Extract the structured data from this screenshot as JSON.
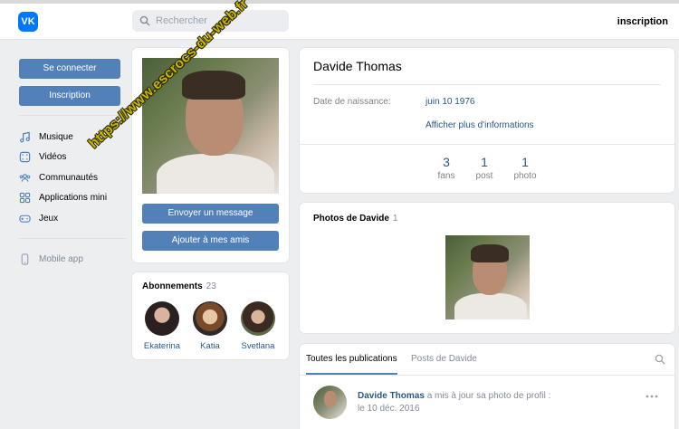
{
  "header": {
    "logo_text": "VK",
    "search_placeholder": "Rechercher",
    "signup_link": "inscription"
  },
  "left_nav": {
    "login_button": "Se connecter",
    "signup_button": "Inscription",
    "items": [
      {
        "label": "Musique",
        "icon": "music-icon"
      },
      {
        "label": "Vidéos",
        "icon": "video-icon"
      },
      {
        "label": "Communautés",
        "icon": "groups-icon"
      },
      {
        "label": "Applications mini",
        "icon": "apps-icon"
      },
      {
        "label": "Jeux",
        "icon": "gamepad-icon"
      }
    ],
    "mobile_app": "Mobile app"
  },
  "photo_card": {
    "send_message": "Envoyer un message",
    "add_friend": "Ajouter à mes amis"
  },
  "subscriptions": {
    "title": "Abonnements",
    "count": "23",
    "people": [
      {
        "name": "Ekaterina"
      },
      {
        "name": "Katia"
      },
      {
        "name": "Svetlana"
      }
    ]
  },
  "profile": {
    "name": "Davide Thomas",
    "birth_label": "Date de naissance:",
    "birth_value": "juin 10 1976",
    "more_info": "Afficher plus d'informations",
    "stats": [
      {
        "num": "3",
        "label": "fans"
      },
      {
        "num": "1",
        "label": "post"
      },
      {
        "num": "1",
        "label": "photo"
      }
    ]
  },
  "photos": {
    "title": "Photos de Davide",
    "count": "1"
  },
  "feed": {
    "tab_all": "Toutes les publications",
    "tab_own": "Posts de Davide",
    "post_author": "Davide Thomas",
    "post_action": "a mis à jour sa photo de profil :",
    "post_date": "le 10 déc. 2016"
  },
  "watermark": "https://www.escrocs-du-web.fr",
  "colors": {
    "accent": "#5181b8",
    "link": "#2a5885",
    "vk_blue": "#0077ff",
    "background": "#edeef0",
    "watermark": "#c8b400"
  }
}
